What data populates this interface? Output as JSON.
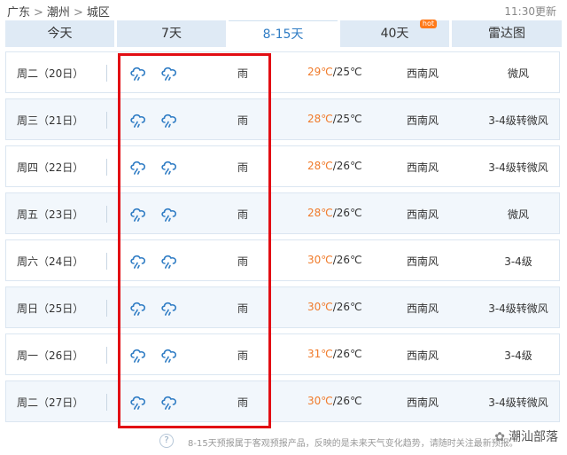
{
  "breadcrumb": {
    "province": "广东",
    "city": "潮州",
    "district": "城区",
    "sep": ">"
  },
  "update_time": "11:30更新",
  "tabs": [
    {
      "label": "今天"
    },
    {
      "label": "7天"
    },
    {
      "label": "8-15天"
    },
    {
      "label": "40天",
      "badge": "hot"
    },
    {
      "label": "雷达图"
    }
  ],
  "forecast": [
    {
      "date": "周二（20日）",
      "condition": "雨",
      "high": "29℃",
      "low": "/25℃",
      "wind_dir": "西南风",
      "wind_level": "微风"
    },
    {
      "date": "周三（21日）",
      "condition": "雨",
      "high": "28℃",
      "low": "/25℃",
      "wind_dir": "西南风",
      "wind_level": "3-4级转微风"
    },
    {
      "date": "周四（22日）",
      "condition": "雨",
      "high": "28℃",
      "low": "/26℃",
      "wind_dir": "西南风",
      "wind_level": "3-4级转微风"
    },
    {
      "date": "周五（23日）",
      "condition": "雨",
      "high": "28℃",
      "low": "/26℃",
      "wind_dir": "西南风",
      "wind_level": "微风"
    },
    {
      "date": "周六（24日）",
      "condition": "雨",
      "high": "30℃",
      "low": "/26℃",
      "wind_dir": "西南风",
      "wind_level": "3-4级"
    },
    {
      "date": "周日（25日）",
      "condition": "雨",
      "high": "30℃",
      "low": "/26℃",
      "wind_dir": "西南风",
      "wind_level": "3-4级转微风"
    },
    {
      "date": "周一（26日）",
      "condition": "雨",
      "high": "31℃",
      "low": "/26℃",
      "wind_dir": "西南风",
      "wind_level": "3-4级"
    },
    {
      "date": "周二（27日）",
      "condition": "雨",
      "high": "30℃",
      "low": "/26℃",
      "wind_dir": "西南风",
      "wind_level": "3-4级转微风"
    }
  ],
  "icons": {
    "weather": "rain-cloud-icon",
    "help": "question-icon"
  },
  "colors": {
    "active_tab": "#2f7cc4",
    "tab_bg": "#dfeaf5",
    "high_temp": "#f07b2b",
    "highlight": "#e20e14",
    "icon": "#2f7cc4"
  },
  "footer": {
    "help_symbol": "?",
    "note": "8-15天预报属于客观预报产品，反映的是未来天气变化趋势，请随时关注最新预报。",
    "watermark": "潮汕部落"
  }
}
